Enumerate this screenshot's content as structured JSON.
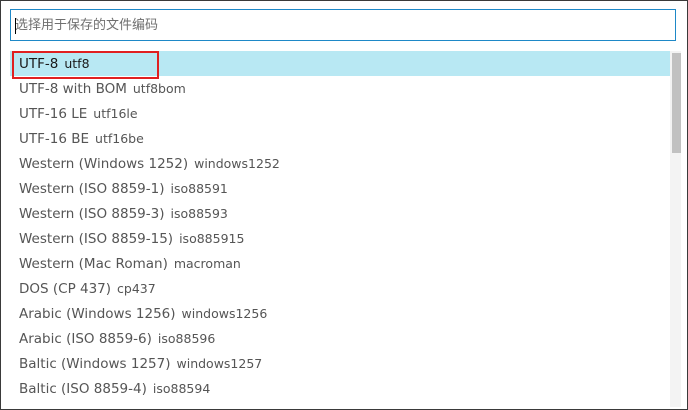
{
  "search": {
    "placeholder": "选择用于保存的文件编码",
    "value": ""
  },
  "encodings": [
    {
      "label": "UTF-8",
      "id": "utf8",
      "selected": true
    },
    {
      "label": "UTF-8 with BOM",
      "id": "utf8bom"
    },
    {
      "label": "UTF-16 LE",
      "id": "utf16le"
    },
    {
      "label": "UTF-16 BE",
      "id": "utf16be"
    },
    {
      "label": "Western (Windows 1252)",
      "id": "windows1252"
    },
    {
      "label": "Western (ISO 8859-1)",
      "id": "iso88591"
    },
    {
      "label": "Western (ISO 8859-3)",
      "id": "iso88593"
    },
    {
      "label": "Western (ISO 8859-15)",
      "id": "iso885915"
    },
    {
      "label": "Western (Mac Roman)",
      "id": "macroman"
    },
    {
      "label": "DOS (CP 437)",
      "id": "cp437"
    },
    {
      "label": "Arabic (Windows 1256)",
      "id": "windows1256"
    },
    {
      "label": "Arabic (ISO 8859-6)",
      "id": "iso88596"
    },
    {
      "label": "Baltic (Windows 1257)",
      "id": "windows1257"
    },
    {
      "label": "Baltic (ISO 8859-4)",
      "id": "iso88594"
    }
  ],
  "colors": {
    "selected_bg": "#b8e8f3",
    "focus_border": "#1e88c7",
    "annotation": "#e02020"
  }
}
